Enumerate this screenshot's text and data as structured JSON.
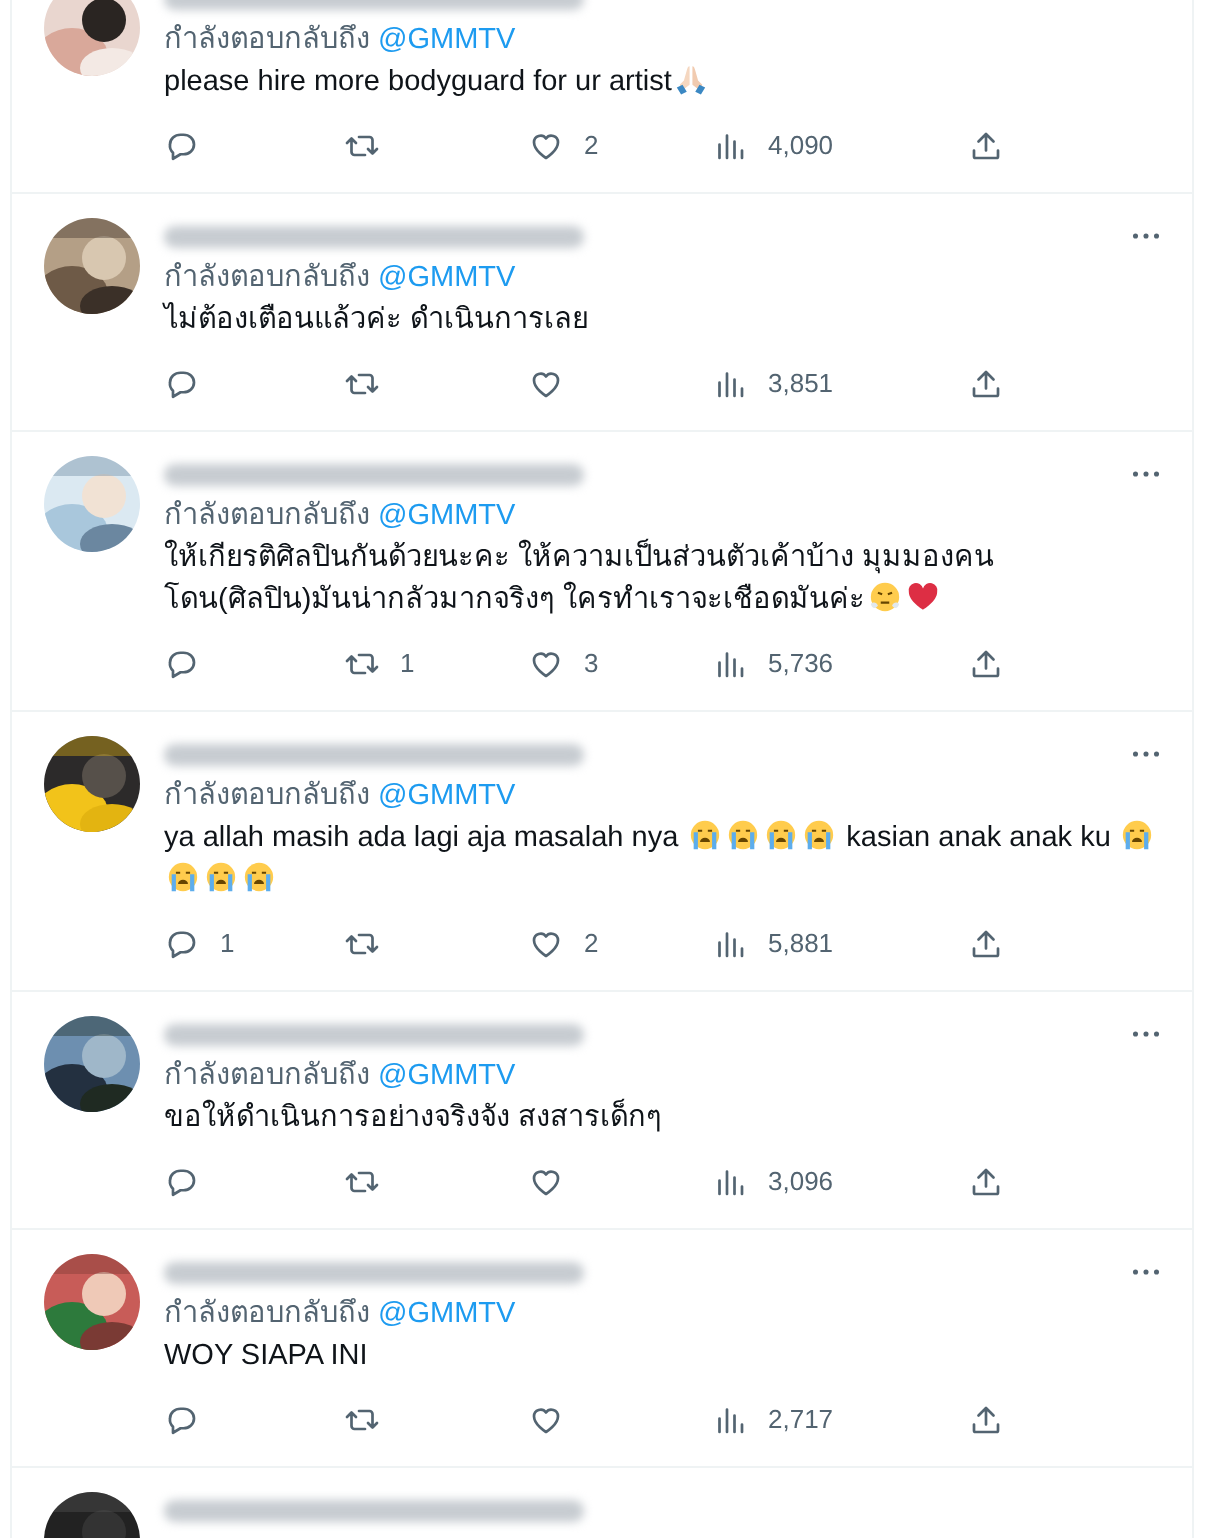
{
  "replies": [
    {
      "kind": "cut-top",
      "reply_label": "กำลังตอบกลับถึง",
      "reply_handle": "@GMMTV",
      "segments": [
        {
          "kind": "text",
          "text": "please hire more bodyguard for ur artist"
        },
        {
          "kind": "praying-hands"
        }
      ],
      "stats": {
        "like": "2",
        "views": "4,090"
      }
    },
    {
      "kind": "full",
      "reply_label": "กำลังตอบกลับถึง",
      "reply_handle": "@GMMTV",
      "segments": [
        {
          "kind": "text",
          "text": "ไม่ต้องเตือนแล้วค่ะ ดำเนินการเลย"
        }
      ],
      "stats": {
        "views": "3,851"
      }
    },
    {
      "kind": "full",
      "reply_label": "กำลังตอบกลับถึง",
      "reply_handle": "@GMMTV",
      "segments": [
        {
          "kind": "text",
          "text": "ให้เกียรติศิลปินกันด้วยนะคะ ให้ความเป็นส่วนตัวเค้าบ้าง มุมมองคนโดน(ศิลปิน)มันน่ากลัวมากจริงๆ  ใครทำเราจะเชือดมันค่ะ"
        },
        {
          "kind": "steaming-face"
        },
        {
          "kind": "red-heart"
        }
      ],
      "stats": {
        "retweet": "1",
        "like": "3",
        "views": "5,736"
      }
    },
    {
      "kind": "full",
      "reply_label": "กำลังตอบกลับถึง",
      "reply_handle": "@GMMTV",
      "segments": [
        {
          "kind": "text",
          "text": "ya allah masih ada lagi aja masalah nya "
        },
        {
          "kind": "crying-face"
        },
        {
          "kind": "crying-face"
        },
        {
          "kind": "crying-face"
        },
        {
          "kind": "crying-face"
        },
        {
          "kind": "text",
          "text": " kasian anak anak ku "
        },
        {
          "kind": "crying-face"
        },
        {
          "kind": "crying-face"
        },
        {
          "kind": "crying-face"
        },
        {
          "kind": "crying-face"
        }
      ],
      "stats": {
        "reply": "1",
        "like": "2",
        "views": "5,881"
      }
    },
    {
      "kind": "full",
      "reply_label": "กำลังตอบกลับถึง",
      "reply_handle": "@GMMTV",
      "segments": [
        {
          "kind": "text",
          "text": "ขอให้ดำเนินการอย่างจริงจัง สงสารเด็กๆ"
        }
      ],
      "stats": {
        "views": "3,096"
      }
    },
    {
      "kind": "full",
      "reply_label": "กำลังตอบกลับถึง",
      "reply_handle": "@GMMTV",
      "segments": [
        {
          "kind": "text",
          "text": "WOY SIAPA INI"
        }
      ],
      "stats": {
        "views": "2,717"
      }
    },
    {
      "kind": "cut-bottom"
    }
  ]
}
